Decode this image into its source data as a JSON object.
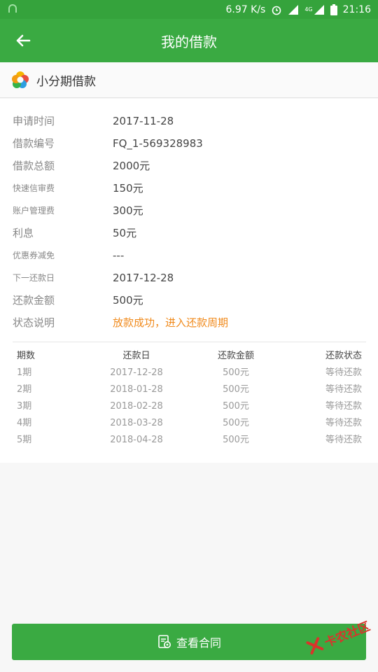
{
  "status": {
    "speed": "6.97 K/s",
    "time": "21:16",
    "network": "4G"
  },
  "appbar": {
    "title": "我的借款"
  },
  "product": {
    "name": "小分期借款"
  },
  "details": [
    {
      "label": "申请时间",
      "value": "2017-11-28",
      "small": false,
      "highlight": false
    },
    {
      "label": "借款编号",
      "value": "FQ_1-569328983",
      "small": false,
      "highlight": false
    },
    {
      "label": "借款总额",
      "value": "2000元",
      "small": false,
      "highlight": false
    },
    {
      "label": "快速信审费",
      "value": "150元",
      "small": true,
      "highlight": false
    },
    {
      "label": "账户管理费",
      "value": "300元",
      "small": true,
      "highlight": false
    },
    {
      "label": "利息",
      "value": "50元",
      "small": false,
      "highlight": false
    },
    {
      "label": "优惠券减免",
      "value": "---",
      "small": true,
      "highlight": false
    },
    {
      "label": "下一还款日",
      "value": "2017-12-28",
      "small": true,
      "highlight": false
    },
    {
      "label": "还款金额",
      "value": "500元",
      "small": false,
      "highlight": false
    },
    {
      "label": "状态说明",
      "value": "放款成功，进入还款周期",
      "small": false,
      "highlight": true
    }
  ],
  "schedule": {
    "headers": [
      "期数",
      "还款日",
      "还款金额",
      "还款状态"
    ],
    "rows": [
      [
        "1期",
        "2017-12-28",
        "500元",
        "等待还款"
      ],
      [
        "2期",
        "2018-01-28",
        "500元",
        "等待还款"
      ],
      [
        "3期",
        "2018-02-28",
        "500元",
        "等待还款"
      ],
      [
        "4期",
        "2018-03-28",
        "500元",
        "等待还款"
      ],
      [
        "5期",
        "2018-04-28",
        "500元",
        "等待还款"
      ]
    ]
  },
  "footer": {
    "button_label": "查看合同"
  },
  "watermark": {
    "text": "卡农社区"
  },
  "colors": {
    "primary": "#3aaa42",
    "status_bar": "#35a33c",
    "highlight": "#f08a1c"
  }
}
